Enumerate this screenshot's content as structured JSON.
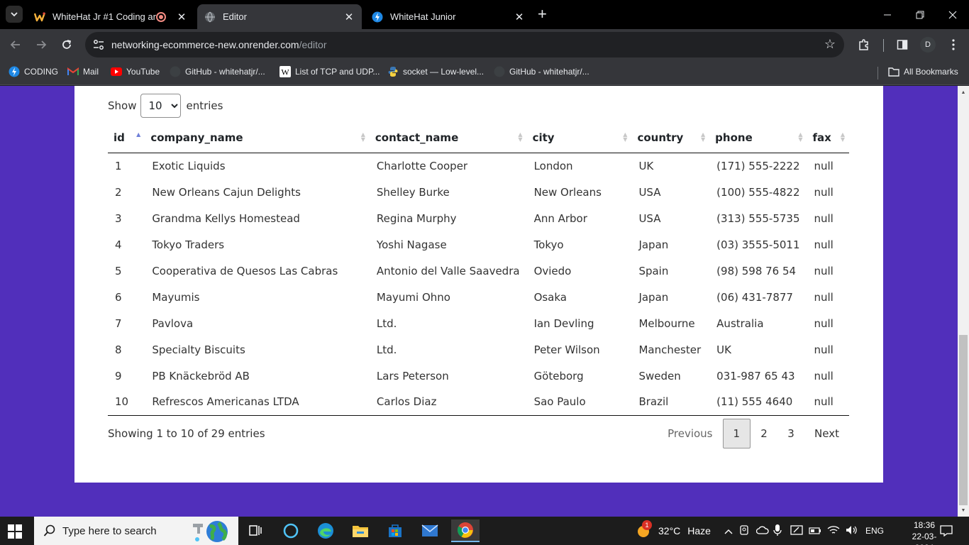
{
  "browser": {
    "tabs": [
      {
        "title": "WhiteHat Jr #1 Coding and",
        "icon": "whitehat-icon",
        "recording": true
      },
      {
        "title": "Editor",
        "icon": "globe-icon",
        "active": true
      },
      {
        "title": "WhiteHat Junior",
        "icon": "whitehat-junior-icon"
      }
    ],
    "url_host": "networking-ecommerce-new.onrender.com",
    "url_path": "/editor",
    "profile_initial": "D",
    "bookmarks": [
      {
        "label": "CODING",
        "icon": "coding-icon"
      },
      {
        "label": "Mail",
        "icon": "gmail-icon"
      },
      {
        "label": "YouTube",
        "icon": "youtube-icon"
      },
      {
        "label": "GitHub - whitehatjr/...",
        "icon": "github-icon"
      },
      {
        "label": "List of TCP and UDP...",
        "icon": "wikipedia-icon"
      },
      {
        "label": "socket — Low-level...",
        "icon": "python-icon"
      },
      {
        "label": "GitHub - whitehatjr/...",
        "icon": "github-icon"
      }
    ],
    "all_bookmarks": "All Bookmarks"
  },
  "datatable": {
    "length": {
      "prefix": "Show",
      "value": "10",
      "suffix": "entries"
    },
    "columns": [
      "id",
      "company_name",
      "contact_name",
      "city",
      "country",
      "phone",
      "fax"
    ],
    "sorted_column": "id",
    "rows": [
      [
        "1",
        "Exotic Liquids",
        "Charlotte Cooper",
        "London",
        "UK",
        "(171) 555-2222",
        "null"
      ],
      [
        "2",
        "New Orleans Cajun Delights",
        "Shelley Burke",
        "New Orleans",
        "USA",
        "(100) 555-4822",
        "null"
      ],
      [
        "3",
        "Grandma Kellys Homestead",
        "Regina Murphy",
        "Ann Arbor",
        "USA",
        "(313) 555-5735",
        "null"
      ],
      [
        "4",
        "Tokyo Traders",
        "Yoshi Nagase",
        "Tokyo",
        "Japan",
        "(03) 3555-5011",
        "null"
      ],
      [
        "5",
        "Cooperativa de Quesos Las Cabras",
        "Antonio del Valle Saavedra",
        "Oviedo",
        "Spain",
        "(98) 598 76 54",
        "null"
      ],
      [
        "6",
        "Mayumis",
        "Mayumi Ohno",
        "Osaka",
        "Japan",
        "(06) 431-7877",
        "null"
      ],
      [
        "7",
        "Pavlova",
        "Ltd.",
        "Ian Devling",
        "Melbourne",
        "Australia",
        "null"
      ],
      [
        "8",
        "Specialty Biscuits",
        "Ltd.",
        "Peter Wilson",
        "Manchester",
        "UK",
        "null"
      ],
      [
        "9",
        "PB Knäckebröd AB",
        "Lars Peterson",
        "Göteborg",
        "Sweden",
        "031-987 65 43",
        "null"
      ],
      [
        "10",
        "Refrescos Americanas LTDA",
        "Carlos Diaz",
        "Sao Paulo",
        "Brazil",
        "(11) 555 4640",
        "null"
      ]
    ],
    "info": "Showing 1 to 10 of 29 entries",
    "pagination": {
      "previous": "Previous",
      "pages": [
        "1",
        "2",
        "3"
      ],
      "current": "1",
      "next": "Next"
    }
  },
  "taskbar": {
    "search_placeholder": "Type here to search",
    "weather_temp": "32°C",
    "weather_desc": "Haze",
    "weather_badge": "1",
    "language": "ENG",
    "time": "18:36",
    "date": "22-03-2024"
  },
  "colors": {
    "page_background": "#512fbb",
    "card": "#ffffff",
    "sort_active": "#6f7fd8"
  }
}
